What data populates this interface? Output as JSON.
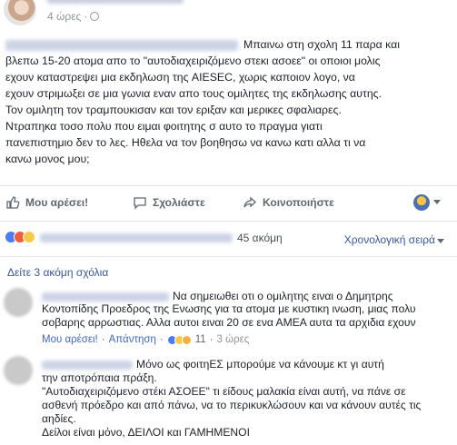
{
  "post": {
    "time": "4 ώρες",
    "separator": "·",
    "text_lines": [
      "Μπαινω στη σχολη 11 παρα και",
      "βλεπω 15-20 ατομα απο το \"αυτοδιαχειριζόμενο στεκι ασοεε\" οι οποιοι μολις",
      "εχουν καταστρεψει μια εκδηλωση της AIESEC, χωρις καποιον λογο, να",
      "εχουν στριμωξει σε μια γωνια εναν απο τους ομιλητες της εκδηλωσης αυτης.",
      "Τον ομιλητη τον τραμπουκισαν και τον εριξαν και μερικες σφαλιαρες.",
      "Ντραπηκα τοσο πολυ που ειμαι φοιτητης σ αυτο το πραγμα γιατι",
      "πανεπιστημιο δεν το λες. Ηθελα να τον βοηθησω να κανω κατι αλλα τι να",
      "κανω μονος μου;"
    ]
  },
  "actions": {
    "like": "Μου αρέσει!",
    "comment": "Σχολιάστε",
    "share": "Κοινοποιήστε"
  },
  "reactions": {
    "more": "45 ακόμη",
    "sort": "Χρονολογική σειρά"
  },
  "comments_more": "Δείτε 3 ακόμη σχόλια",
  "comments": [
    {
      "text_lines": [
        "Να σημειωθει οτι ο ομιλητης ειναι ο Δημητρης",
        "Κοντοπίδης Προεδρος της Ενωσης για τα ατομα με κυστικη ινωση, μιας πολυ",
        "σοβαρης αρρωστιας. Αλλα αυτοι ειναι 20 σε ενα ΑΜΕΑ αυτα τα αρχιδια εχουν"
      ],
      "like": "Μου αρέσει!",
      "reply": "Απάντηση",
      "reactions_count": "11",
      "time": "3 ώρες"
    },
    {
      "text_lines": [
        "Μόνο ως φοιτηΕΣ μπορούμε να κάνουμε κτ γι αυτή",
        "την αποτρόπαια πράξη.",
        "\"Αυτοδιαχειριζόμενο στέκι ΑΣΟΕΕ\" τι είδους μαλακία είναι αυτή, να πάνε σε",
        "ασθενή πρόεδρο και από πάνω, να το περικυκλώσουν και να κάνουν αυτές τις",
        "αηδίες.",
        "Δείλοι είναι μόνο, ΔΕΙΛΟΙ και ΓΑΜΗΜΕΝΟΙ"
      ]
    }
  ]
}
